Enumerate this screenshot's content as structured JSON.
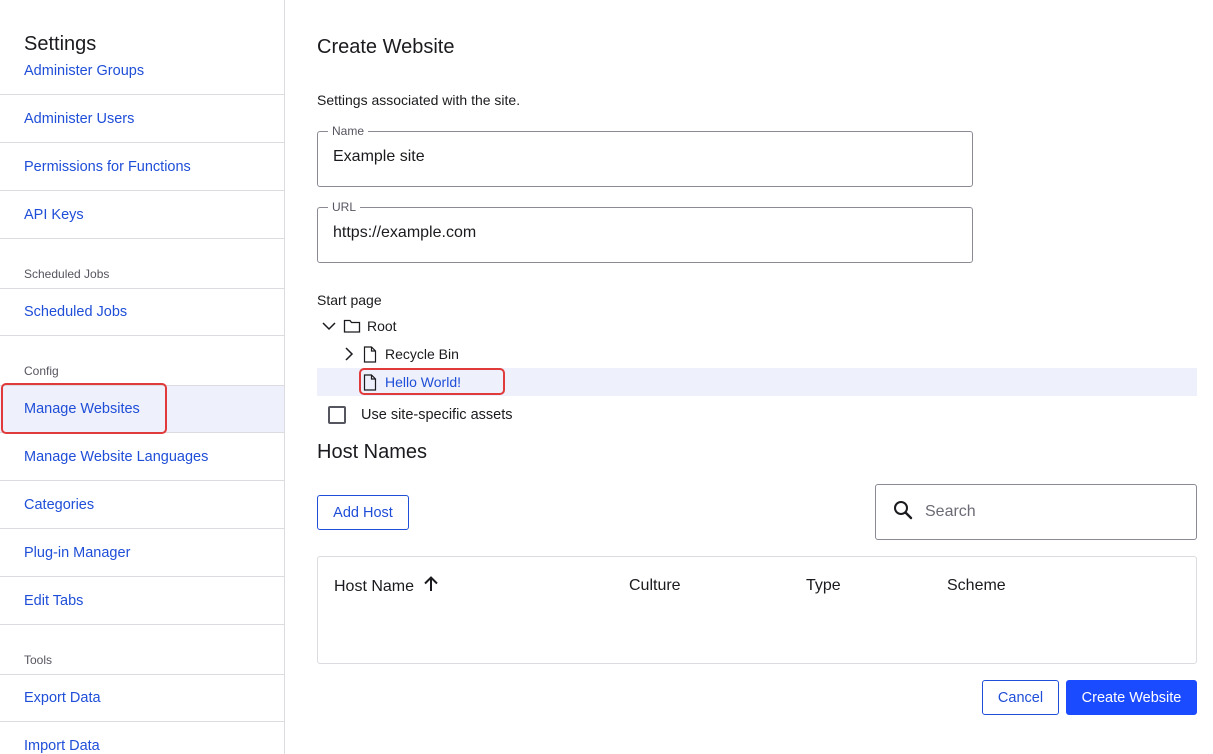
{
  "sidebar": {
    "title": "Settings",
    "items": [
      {
        "label": "Administer Groups"
      },
      {
        "label": "Administer Users"
      },
      {
        "label": "Permissions for Functions"
      },
      {
        "label": "API Keys"
      },
      {
        "label": "Scheduled Jobs"
      },
      {
        "label": "Manage Websites"
      },
      {
        "label": "Manage Website Languages"
      },
      {
        "label": "Categories"
      },
      {
        "label": "Plug-in Manager"
      },
      {
        "label": "Edit Tabs"
      },
      {
        "label": "Export Data"
      },
      {
        "label": "Import Data"
      }
    ],
    "sections": {
      "scheduled": "Scheduled Jobs",
      "config": "Config",
      "tools": "Tools"
    }
  },
  "main": {
    "title": "Create Website",
    "description": "Settings associated with the site.",
    "name_field": {
      "label": "Name",
      "value": "Example site"
    },
    "url_field": {
      "label": "URL",
      "value": "https://example.com"
    },
    "start_page_label": "Start page",
    "tree": {
      "root": "Root",
      "recycle_bin": "Recycle Bin",
      "hello_world": "Hello World!"
    },
    "site_assets_label": "Use site-specific assets",
    "host_names_title": "Host Names",
    "add_host_label": "Add Host",
    "search_placeholder": "Search",
    "table_headers": {
      "host_name": "Host Name",
      "culture": "Culture",
      "type": "Type",
      "scheme": "Scheme"
    },
    "cancel_label": "Cancel",
    "create_label": "Create Website"
  },
  "colors": {
    "accent": "#1b4bff",
    "link": "#1f4ed8",
    "highlight": "#e03a3a",
    "selected_bg": "#eef0fb"
  }
}
